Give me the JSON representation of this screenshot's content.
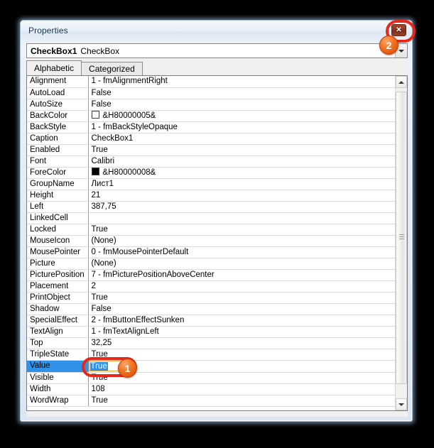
{
  "window": {
    "title": "Properties",
    "close_label": "✕"
  },
  "object_combo": {
    "name": "CheckBox1",
    "type": "CheckBox",
    "arrow_icon": "chevron-down-icon"
  },
  "tabs": [
    {
      "label": "Alphabetic",
      "active": true
    },
    {
      "label": "Categorized",
      "active": false
    }
  ],
  "grid": {
    "rows": [
      {
        "name": "Alignment",
        "value": "1 - fmAlignmentRight"
      },
      {
        "name": "AutoLoad",
        "value": "False"
      },
      {
        "name": "AutoSize",
        "value": "False"
      },
      {
        "name": "BackColor",
        "value": "&H80000005&",
        "swatch": "white"
      },
      {
        "name": "BackStyle",
        "value": "1 - fmBackStyleOpaque"
      },
      {
        "name": "Caption",
        "value": "CheckBox1"
      },
      {
        "name": "Enabled",
        "value": "True"
      },
      {
        "name": "Font",
        "value": "Calibri"
      },
      {
        "name": "ForeColor",
        "value": "&H80000008&",
        "swatch": "black"
      },
      {
        "name": "GroupName",
        "value": "Лист1"
      },
      {
        "name": "Height",
        "value": "21"
      },
      {
        "name": "Left",
        "value": "387,75"
      },
      {
        "name": "LinkedCell",
        "value": ""
      },
      {
        "name": "Locked",
        "value": "True"
      },
      {
        "name": "MouseIcon",
        "value": "(None)"
      },
      {
        "name": "MousePointer",
        "value": "0 - fmMousePointerDefault"
      },
      {
        "name": "Picture",
        "value": "(None)"
      },
      {
        "name": "PicturePosition",
        "value": "7 - fmPicturePositionAboveCenter"
      },
      {
        "name": "Placement",
        "value": "2"
      },
      {
        "name": "PrintObject",
        "value": "True"
      },
      {
        "name": "Shadow",
        "value": "False"
      },
      {
        "name": "SpecialEffect",
        "value": "2 - fmButtonEffectSunken"
      },
      {
        "name": "TextAlign",
        "value": "1 - fmTextAlignLeft"
      },
      {
        "name": "Top",
        "value": "32,25"
      },
      {
        "name": "TripleState",
        "value": "True"
      },
      {
        "name": "Value",
        "value": "True",
        "selected": true,
        "editing": true
      },
      {
        "name": "Visible",
        "value": "True"
      },
      {
        "name": "Width",
        "value": "108"
      },
      {
        "name": "WordWrap",
        "value": "True"
      }
    ]
  },
  "scrollbar": {
    "up_icon": "triangle-up-icon",
    "down_icon": "triangle-down-icon"
  },
  "annotations": [
    {
      "badge": "1",
      "target": "value-row-editor"
    },
    {
      "badge": "2",
      "target": "close-button"
    }
  ],
  "colors": {
    "selection_blue": "#2f92e8",
    "annotation_red": "#e8271a",
    "badge_orange": "#f0711f",
    "close_button": "#8a3520"
  }
}
